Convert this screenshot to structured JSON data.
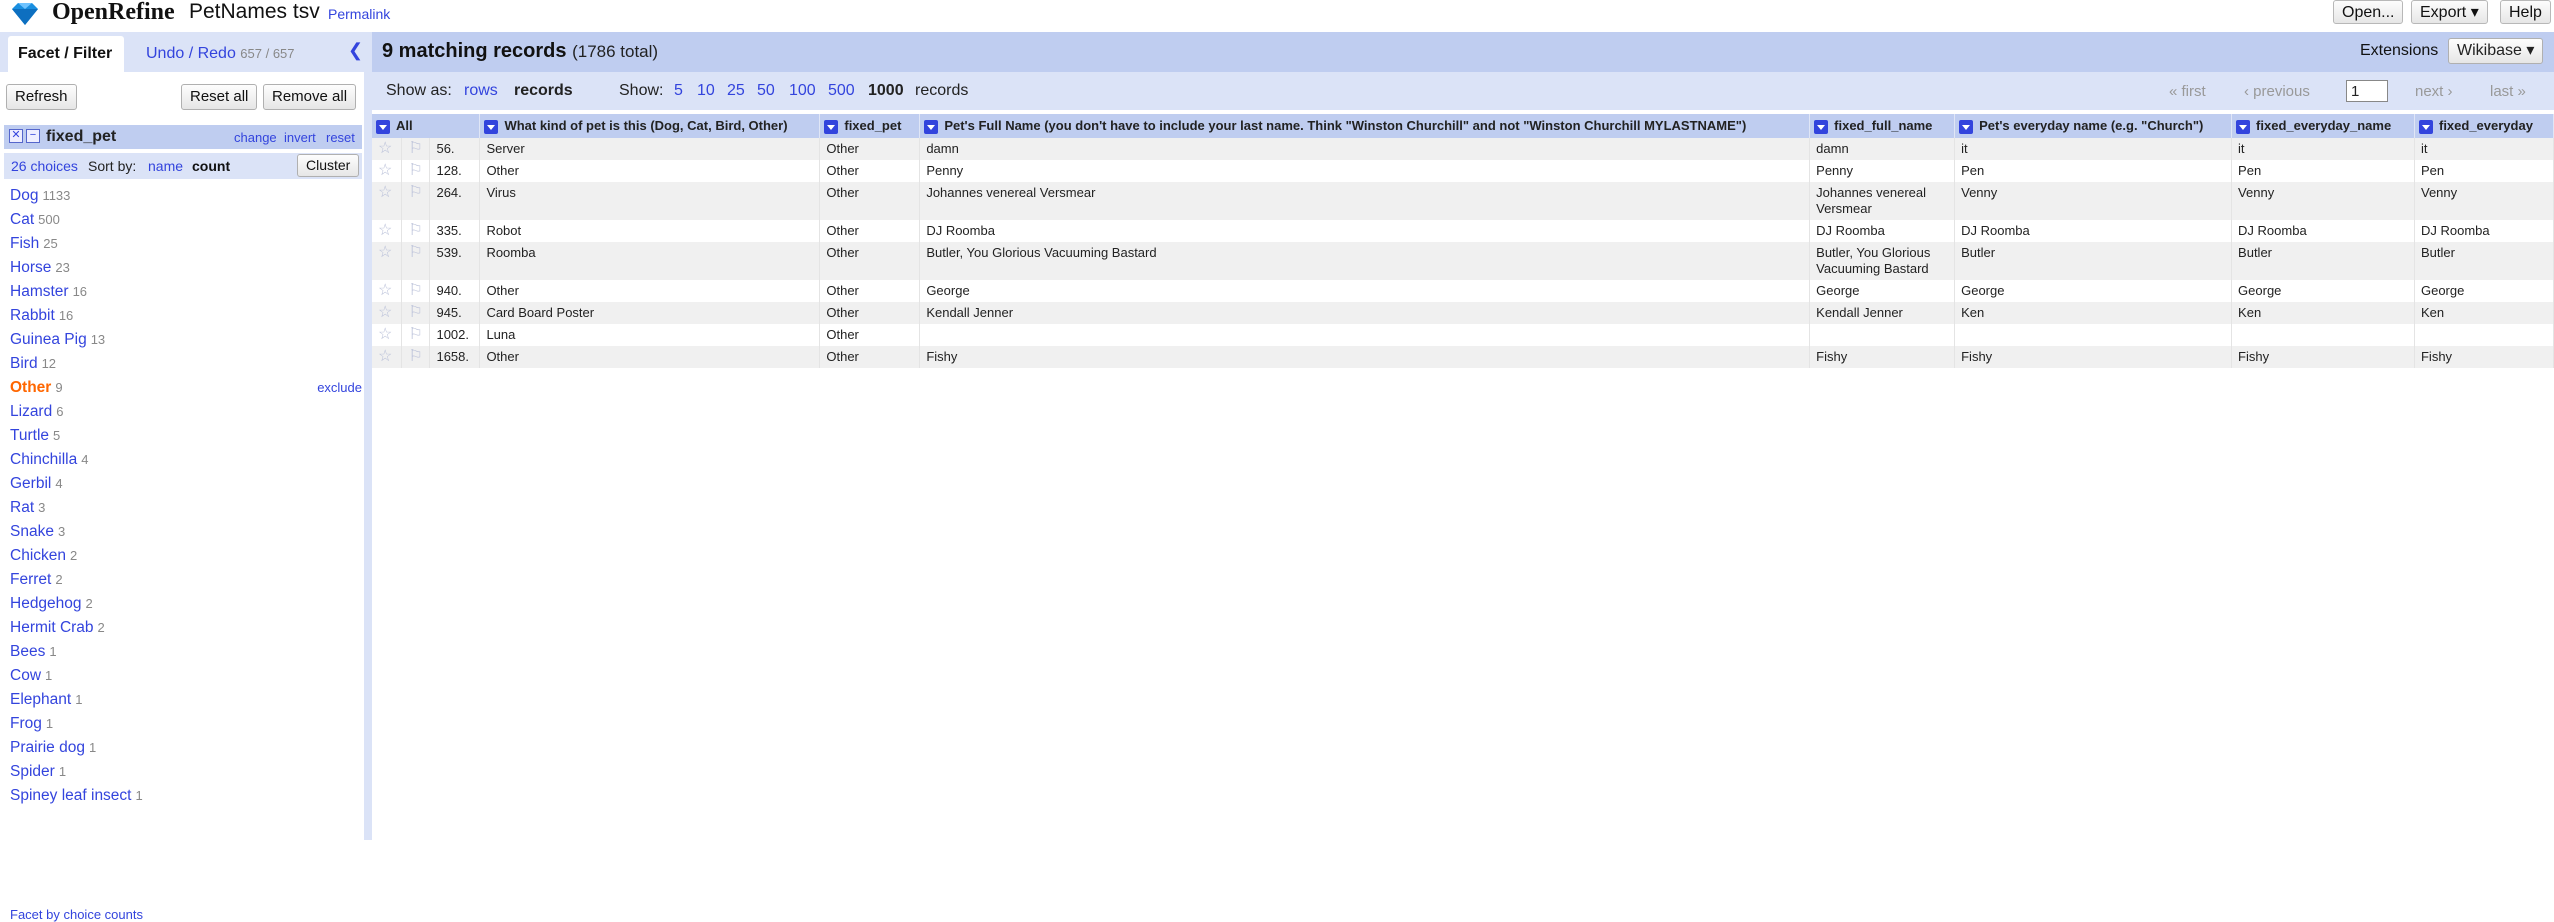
{
  "app": {
    "name": "OpenRefine",
    "project": "PetNames tsv",
    "permalink": "Permalink"
  },
  "header_buttons": {
    "open": "Open...",
    "export": "Export ▾",
    "help": "Help"
  },
  "left": {
    "tab_facet": "Facet / Filter",
    "tab_undo": "Undo / Redo",
    "undo_count": "657 / 657",
    "refresh": "Refresh",
    "reset_all": "Reset all",
    "remove_all": "Remove all",
    "facet": {
      "title": "fixed_pet",
      "change": "change",
      "invert": "invert",
      "reset": "reset",
      "choices_count": "26 choices",
      "sort_by": "Sort by:",
      "sort_name": "name",
      "sort_count": "count",
      "cluster": "Cluster",
      "exclude": "exclude",
      "footer": "Facet by choice counts",
      "choices": [
        {
          "label": "Dog",
          "count": "1133"
        },
        {
          "label": "Cat",
          "count": "500"
        },
        {
          "label": "Fish",
          "count": "25"
        },
        {
          "label": "Horse",
          "count": "23"
        },
        {
          "label": "Hamster",
          "count": "16"
        },
        {
          "label": "Rabbit",
          "count": "16"
        },
        {
          "label": "Guinea Pig",
          "count": "13"
        },
        {
          "label": "Bird",
          "count": "12"
        },
        {
          "label": "Other",
          "count": "9",
          "selected": true
        },
        {
          "label": "Lizard",
          "count": "6"
        },
        {
          "label": "Turtle",
          "count": "5"
        },
        {
          "label": "Chinchilla",
          "count": "4"
        },
        {
          "label": "Gerbil",
          "count": "4"
        },
        {
          "label": "Rat",
          "count": "3"
        },
        {
          "label": "Snake",
          "count": "3"
        },
        {
          "label": "Chicken",
          "count": "2"
        },
        {
          "label": "Ferret",
          "count": "2"
        },
        {
          "label": "Hedgehog",
          "count": "2"
        },
        {
          "label": "Hermit Crab",
          "count": "2"
        },
        {
          "label": "Bees",
          "count": "1"
        },
        {
          "label": "Cow",
          "count": "1"
        },
        {
          "label": "Elephant",
          "count": "1"
        },
        {
          "label": "Frog",
          "count": "1"
        },
        {
          "label": "Prairie dog",
          "count": "1"
        },
        {
          "label": "Spider",
          "count": "1"
        },
        {
          "label": "Spiney leaf insect",
          "count": "1"
        }
      ]
    }
  },
  "summary": {
    "matching": "9 matching records",
    "total": "(1786 total)"
  },
  "extensions": {
    "label": "Extensions",
    "wikibase": "Wikibase ▾"
  },
  "viewbar": {
    "show_as": "Show as:",
    "rows": "rows",
    "records": "records",
    "show": "Show:",
    "sizes": [
      "5",
      "10",
      "25",
      "50",
      "100",
      "500"
    ],
    "selected_size": "1000",
    "records_suffix": "records",
    "first": "« first",
    "previous": "‹ previous",
    "page": "1",
    "next": "next ›",
    "last": "last »"
  },
  "table": {
    "columns": [
      "All",
      "What kind of pet is this (Dog, Cat, Bird, Other)",
      "fixed_pet",
      "Pet's Full Name (you don't have to include your last name. Think \"Winston Churchill\" and not \"Winston Churchill MYLASTNAME\")",
      "fixed_full_name",
      "Pet's everyday name (e.g. \"Church\")",
      "fixed_everyday_name",
      "fixed_everyday"
    ],
    "rows": [
      {
        "idx": "56.",
        "kind": "Server",
        "fixed_pet": "Other",
        "full_name": "damn",
        "fixed_full": "damn",
        "everyday": "it",
        "fixed_everyday": "it",
        "fixed_everyday2": "it"
      },
      {
        "idx": "128.",
        "kind": "Other",
        "fixed_pet": "Other",
        "full_name": "Penny",
        "fixed_full": "Penny",
        "everyday": "Pen",
        "fixed_everyday": "Pen",
        "fixed_everyday2": "Pen"
      },
      {
        "idx": "264.",
        "kind": "Virus",
        "fixed_pet": "Other",
        "full_name": "Johannes venereal Versmear",
        "fixed_full": "Johannes venereal Versmear",
        "everyday": "Venny",
        "fixed_everyday": "Venny",
        "fixed_everyday2": "Venny"
      },
      {
        "idx": "335.",
        "kind": "Robot",
        "fixed_pet": "Other",
        "full_name": "DJ Roomba",
        "fixed_full": "DJ Roomba",
        "everyday": "DJ Roomba",
        "fixed_everyday": "DJ Roomba",
        "fixed_everyday2": "DJ Roomba"
      },
      {
        "idx": "539.",
        "kind": "Roomba",
        "fixed_pet": "Other",
        "full_name": "Butler, You Glorious Vacuuming Bastard",
        "fixed_full": "Butler, You Glorious Vacuuming Bastard",
        "everyday": "Butler",
        "fixed_everyday": "Butler",
        "fixed_everyday2": "Butler"
      },
      {
        "idx": "940.",
        "kind": "Other",
        "fixed_pet": "Other",
        "full_name": "George",
        "fixed_full": "George",
        "everyday": "George",
        "fixed_everyday": "George",
        "fixed_everyday2": "George"
      },
      {
        "idx": "945.",
        "kind": "Card Board Poster",
        "fixed_pet": "Other",
        "full_name": "Kendall Jenner",
        "fixed_full": "Kendall Jenner",
        "everyday": "Ken",
        "fixed_everyday": "Ken",
        "fixed_everyday2": "Ken"
      },
      {
        "idx": "1002.",
        "kind": "Luna",
        "fixed_pet": "Other",
        "full_name": "",
        "fixed_full": "",
        "everyday": "",
        "fixed_everyday": "",
        "fixed_everyday2": ""
      },
      {
        "idx": "1658.",
        "kind": "Other",
        "fixed_pet": "Other",
        "full_name": "Fishy",
        "fixed_full": "Fishy",
        "everyday": "Fishy",
        "fixed_everyday": "Fishy",
        "fixed_everyday2": "Fishy"
      }
    ]
  },
  "colors": {
    "accent": "#3344dd",
    "selected": "#ff6600",
    "header_bg": "#bfcdf0",
    "bar_bg": "#dbe3f7"
  }
}
